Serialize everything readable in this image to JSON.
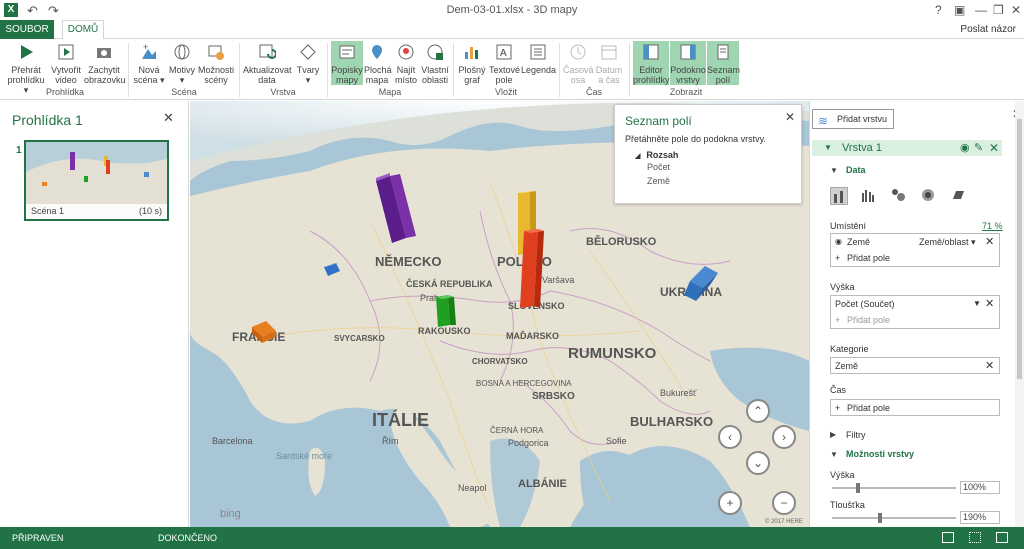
{
  "titlebar": {
    "title": "Dem-03-01.xlsx - 3D mapy",
    "help": "?"
  },
  "tabs": {
    "file": "SOUBOR",
    "home": "DOMŮ",
    "feedback": "Poslat názor"
  },
  "ribbon": {
    "groups": {
      "tour": "Prohlídka",
      "scene": "Scéna",
      "layer": "Vrstva",
      "map": "Mapa",
      "insert": "Vložit",
      "time": "Čas",
      "view": "Zobrazit"
    },
    "buttons": {
      "play_tour": [
        "Přehrát",
        "prohlídku ▾"
      ],
      "create_video": [
        "Vytvořit",
        "video"
      ],
      "capture": [
        "Zachytit",
        "obrazovku"
      ],
      "new_scene": [
        "Nová",
        "scéna ▾"
      ],
      "themes": [
        "Motivy",
        "▾"
      ],
      "scene_options": [
        "Možnosti",
        "scény"
      ],
      "refresh_data": [
        "Aktualizovat",
        "data"
      ],
      "shapes": [
        "Tvary",
        "▾"
      ],
      "map_labels": [
        "Popisky",
        "mapy"
      ],
      "flat_map": [
        "Plochá",
        "mapa"
      ],
      "find_location": [
        "Najít",
        "místo"
      ],
      "custom_regions": [
        "Vlastní",
        "oblasti"
      ],
      "chart_2d": [
        "Plošný",
        "graf"
      ],
      "text_box": [
        "Textové",
        "pole"
      ],
      "legend": [
        "Legenda",
        ""
      ],
      "timeline": [
        "Časová",
        "osa"
      ],
      "date_time": [
        "Datum",
        "a čas"
      ],
      "tour_editor": [
        "Editor",
        "prohlídky"
      ],
      "layer_pane": [
        "Podokno",
        "vrstvy"
      ],
      "field_list": [
        "Seznam",
        "polí"
      ]
    }
  },
  "left_pane": {
    "title": "Prohlídka 1",
    "scene_number": "1",
    "scene_name": "Scéna 1",
    "scene_duration": "(10 s)"
  },
  "map": {
    "labels": [
      "NĚMECKO",
      "POLSKO",
      "FRANCIE",
      "ITÁLIE",
      "RUMUNSKO",
      "BULHARSKO",
      "UKRAJINA",
      "BĚLORUSKO",
      "ČESKÁ REPUBLIKA",
      "RAKOUSKO",
      "MAĎARSKO",
      "SRBSKO",
      "CHORVATSKO",
      "ALBÁNIE",
      "SLOVENSKO",
      "SVYCARSKO",
      "BOSNA A HERCEGOVINA",
      "ČERNÁ HORA"
    ],
    "cities": [
      "Řím",
      "Barcelona",
      "Neapol",
      "Sardské moře",
      "Podgorica",
      "Bukurešť",
      "Sofie",
      "Varšava",
      "Praha"
    ],
    "bing": "bing",
    "copyright": "© 2017 HERE"
  },
  "field_list": {
    "title": "Seznam polí",
    "hint": "Přetáhněte pole do podokna vrstvy.",
    "range": "Rozsah",
    "fields": [
      "Počet",
      "Země"
    ]
  },
  "right_pane": {
    "add_layer": "Přidat vrstvu",
    "layer_name": "Vrstva 1",
    "data_section": "Data",
    "location_label": "Umístění",
    "location_pct": "71 %",
    "location_field": "Země",
    "location_type": "Země/oblast ▾",
    "add_field": "Přidat pole",
    "height_label": "Výška",
    "height_field": "Počet (Součet)",
    "category_label": "Kategorie",
    "category_field": "Země",
    "time_label": "Čas",
    "filters_label": "Filtry",
    "layer_options": "Možnosti vrstvy",
    "opt_height": "Výška",
    "opt_height_val": "100%",
    "opt_thickness": "Tloušťka",
    "opt_thickness_val": "190%"
  },
  "status": {
    "ready": "PŘIPRAVEN",
    "done": "DOKONČENO"
  },
  "colors": {
    "accent": "#217346",
    "selected": "#9fd5b0",
    "sea": "#aac7d8",
    "land": "#e8e4d8"
  }
}
